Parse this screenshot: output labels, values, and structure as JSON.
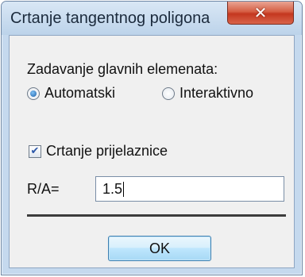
{
  "window": {
    "title": "Crtanje tangentnog poligona",
    "close_glyph": "✕"
  },
  "group": {
    "label": "Zadavanje glavnih elemenata:",
    "options": [
      {
        "label": "Automatski",
        "selected": true
      },
      {
        "label": "Interaktivno",
        "selected": false
      }
    ]
  },
  "checkbox": {
    "label": "Crtanje prijelaznice",
    "checked": true,
    "check_glyph": "✔"
  },
  "ratio": {
    "label": "R/A=",
    "value": "1.5"
  },
  "buttons": {
    "ok_label": "OK"
  },
  "colors": {
    "close_button": "#d65f44",
    "ok_button_border": "#3c7fb1",
    "radio_selected": "#1c5fa8"
  },
  "icons": {
    "close": "close-icon",
    "radio_selected": "radio-selected-icon",
    "radio_unselected": "radio-unselected-icon",
    "check": "check-icon"
  }
}
